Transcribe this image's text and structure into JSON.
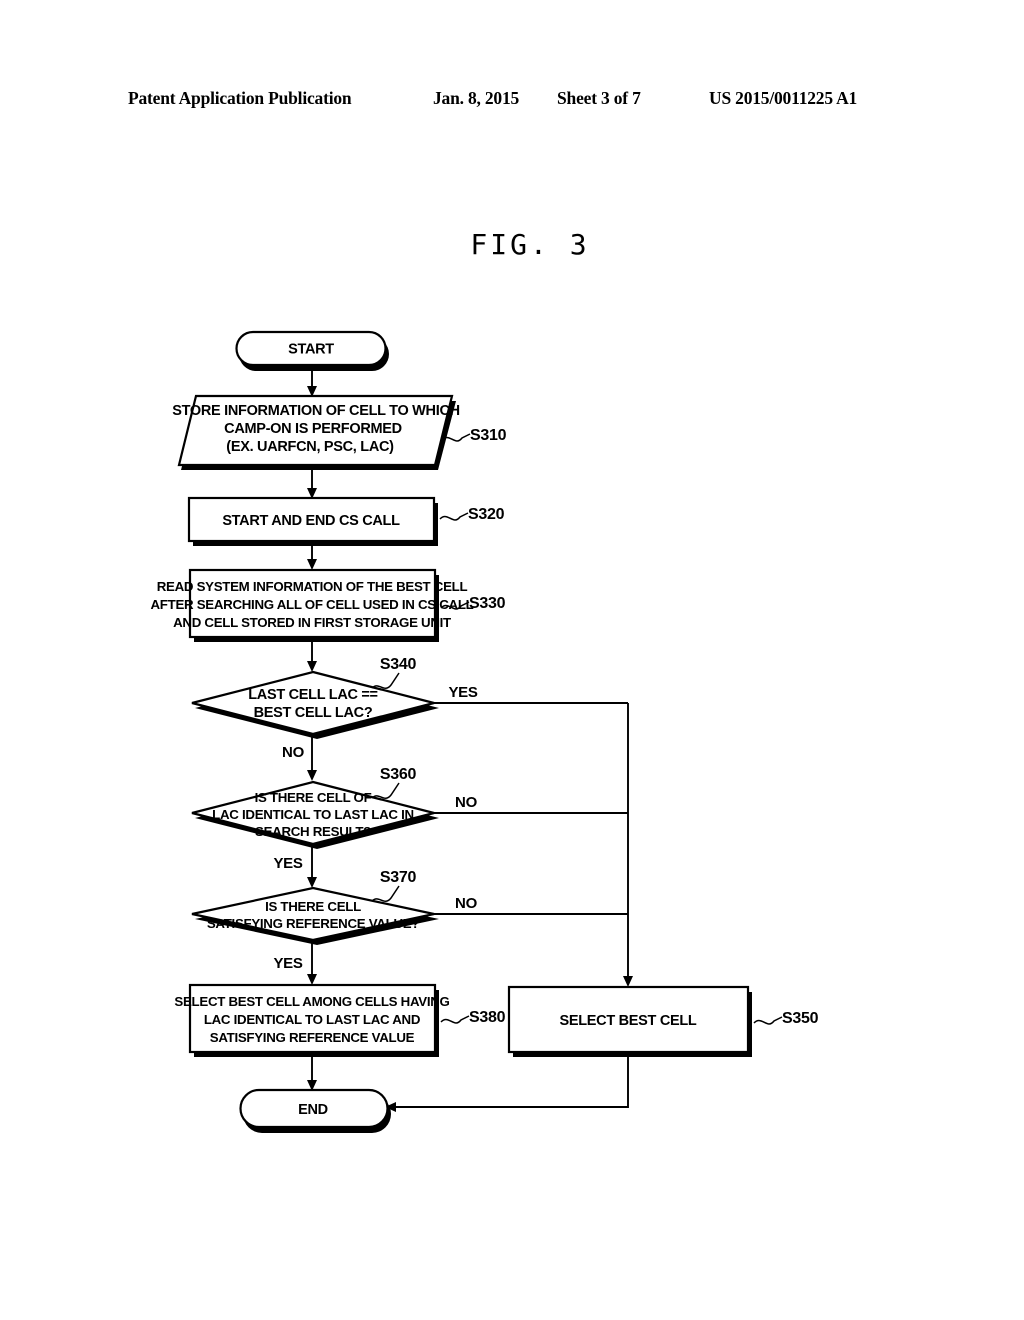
{
  "header": {
    "publication": "Patent Application Publication",
    "date": "Jan. 8, 2015",
    "sheet": "Sheet 3 of 7",
    "number": "US 2015/0011225 A1"
  },
  "figure": {
    "title": "FIG. 3"
  },
  "flowchart": {
    "nodes": {
      "start": {
        "label": "START",
        "shape": "terminator"
      },
      "s310": {
        "ref": "S310",
        "shape": "parallelogram",
        "lines": [
          "STORE INFORMATION OF CELL TO WHICH",
          "CAMP-ON IS PERFORMED",
          "(EX. UARFCN, PSC, LAC)"
        ]
      },
      "s320": {
        "ref": "S320",
        "shape": "process",
        "lines": [
          "START AND END CS CALL"
        ]
      },
      "s330": {
        "ref": "S330",
        "shape": "process",
        "lines": [
          "READ SYSTEM INFORMATION OF THE BEST CELL",
          "AFTER SEARCHING ALL OF CELL USED IN CS CALL",
          "AND CELL STORED IN FIRST STORAGE UNIT"
        ]
      },
      "s340": {
        "ref": "S340",
        "shape": "decision",
        "lines": [
          "LAST CELL LAC ==",
          "BEST CELL LAC?"
        ],
        "yes_branch": "YES",
        "no_branch": "NO"
      },
      "s360": {
        "ref": "S360",
        "shape": "decision",
        "lines": [
          "IS THERE CELL OF",
          "LAC IDENTICAL TO LAST LAC IN",
          "SEARCH RESULT?"
        ],
        "yes_branch": "YES",
        "no_branch": "NO"
      },
      "s370": {
        "ref": "S370",
        "shape": "decision",
        "lines": [
          "IS THERE CELL",
          "SATISFYING REFERENCE VALUE?"
        ],
        "yes_branch": "YES",
        "no_branch": "NO"
      },
      "s380": {
        "ref": "S380",
        "shape": "process",
        "lines": [
          "SELECT BEST CELL AMONG CELLS HAVING",
          "LAC IDENTICAL TO LAST LAC AND",
          "SATISFYING REFERENCE VALUE"
        ]
      },
      "s350": {
        "ref": "S350",
        "shape": "process",
        "lines": [
          "SELECT BEST CELL"
        ]
      },
      "end": {
        "label": "END",
        "shape": "terminator"
      }
    },
    "colors": {
      "stroke": "#000000",
      "fill": "#ffffff",
      "background": "#ffffff"
    }
  }
}
